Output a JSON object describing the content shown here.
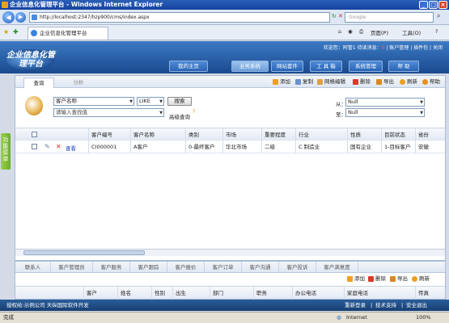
{
  "window": {
    "title": "企业信息化管理平台 - Windows Internet Explorer"
  },
  "browser": {
    "url": "http://localhost:2347/hzp900/cms/index.aspx",
    "search_placeholder": "Google",
    "tab_title": "企业信息化管理平台",
    "toolbar": {
      "page": "页面(P)",
      "tools": "工具(O)"
    }
  },
  "header": {
    "logo_text": "企业信息化管理平台",
    "welcome": "欢迎您：阿管1 待读消息：",
    "msg_count": "0",
    "links": [
      "账户管理",
      "插件包",
      "关闭"
    ],
    "nav": [
      "我的主页",
      "业务系统",
      "网站套件",
      "工 具 箱",
      "系统管理",
      "帮 助"
    ],
    "active_nav": "业务系统"
  },
  "sidebar": {
    "tab_label": "功能菜单"
  },
  "main": {
    "tabs": [
      "查询",
      "分析"
    ],
    "tools": [
      "添加",
      "复制",
      "网格编辑",
      "删除",
      "导出",
      "刷新",
      "帮助"
    ],
    "query": {
      "field": "客户名称",
      "op": "LIKE",
      "search_button": "搜索",
      "placeholder": "请输入查找值",
      "advanced": "高级查询",
      "from_label": "从：",
      "to_label": "至：",
      "from_value": "Null",
      "to_value": "Null"
    },
    "grid": {
      "columns": [
        "客户编号",
        "客户名称",
        "类别",
        "市场",
        "重要程度",
        "行业",
        "性质",
        "目前状态",
        "省份"
      ],
      "rows": [
        {
          "view": "查看",
          "cells": [
            "CI000001",
            "A客户",
            "0-最终客户",
            "华北市场",
            "二级",
            "C 制造业",
            "国有企业",
            "1-目标客户",
            "安徽"
          ]
        }
      ]
    }
  },
  "bottom": {
    "tabs": [
      "联系人",
      "客户管理员",
      "客户服务",
      "客户跟踪",
      "客户报价",
      "客户订单",
      "客户沟通",
      "客户投诉",
      "客户满意度"
    ],
    "tools": [
      "添加",
      "删除",
      "导出",
      "刷新"
    ],
    "columns": [
      "客户",
      "姓名",
      "性别",
      "出生",
      "部门",
      "职务",
      "办公电话",
      "家庭电话",
      "传真"
    ]
  },
  "footer": {
    "left": "授权给:示例公司 天纵国际软件开发",
    "right": [
      "重新登录",
      "技术支持",
      "安全退出"
    ]
  },
  "status": {
    "left": "完成",
    "zone": "Internet",
    "zoom": "100%"
  }
}
